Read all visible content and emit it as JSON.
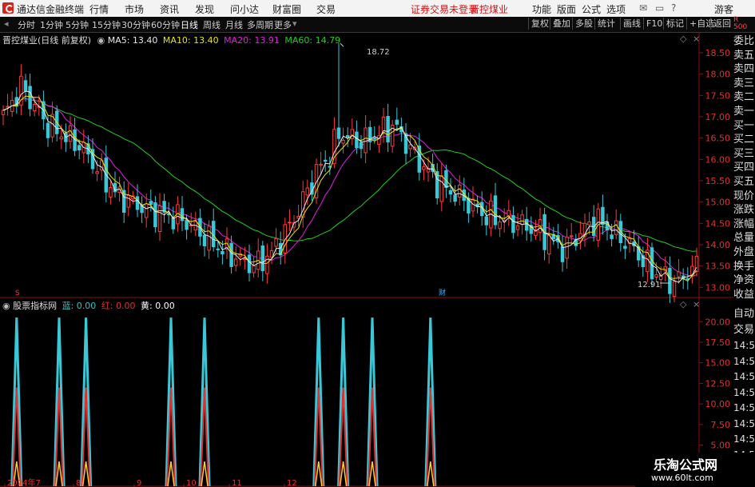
{
  "app": {
    "title": "通达信金融终端",
    "menu": [
      "行情",
      "市场",
      "资讯",
      "发现",
      "问小达",
      "财富圈",
      "交易"
    ],
    "warning": "证券交易未登录",
    "stock_short": "晋控煤业",
    "right_menu": [
      "功能",
      "版面",
      "公式",
      "选项"
    ],
    "user": "游客"
  },
  "toolbar": {
    "periods": [
      "分时",
      "1分钟",
      "5分钟",
      "15分钟",
      "30分钟",
      "60分钟",
      "日线",
      "周线",
      "月线",
      "多周期",
      "更多"
    ],
    "selected": "日线",
    "right": [
      "复权",
      "叠加",
      "多股",
      "统计",
      "画线",
      "F10",
      "标记",
      "+自选",
      "返回"
    ]
  },
  "main_chart": {
    "title": "晋控煤业(日线 前复权)",
    "ma": [
      {
        "label": "MA5: 13.40",
        "color": "#e8e8e8"
      },
      {
        "label": "MA10: 13.40",
        "color": "#e6e600"
      },
      {
        "label": "MA20: 13.91",
        "color": "#e020e0"
      },
      {
        "label": "MA60: 14.79",
        "color": "#20d020"
      }
    ],
    "y_ticks": [
      "18.50",
      "18.00",
      "17.50",
      "17.00",
      "16.50",
      "16.00",
      "15.50",
      "15.00",
      "14.50",
      "14.00",
      "13.50",
      "13.00"
    ],
    "max_label": "18.72",
    "min_label": "12.91",
    "event_marks": [
      "S",
      "财"
    ]
  },
  "sub_chart": {
    "title": "股票指标网",
    "values": [
      {
        "label": "蓝: 0.00",
        "color": "#3fbfbf"
      },
      {
        "label": "红: 0.00",
        "color": "#e03030"
      },
      {
        "label": "黄: 0.00",
        "color": "#ffffff"
      }
    ],
    "y_ticks": [
      "20.00",
      "17.50",
      "15.00",
      "12.50",
      "10.00",
      "7.50",
      "5.00"
    ]
  },
  "x_axis": [
    "2024年7",
    "8",
    "9",
    "10",
    "11",
    "12"
  ],
  "side_panel": {
    "top": [
      "委比",
      "卖五",
      "卖四",
      "卖三",
      "卖二",
      "卖一",
      "买一",
      "买二",
      "买三",
      "买四",
      "买五",
      "现价",
      "涨跌",
      "涨幅",
      "总量",
      "外盘",
      "换手",
      "净资",
      "收益"
    ],
    "lower": [
      "自动",
      "交易",
      "14:56",
      "14:56",
      "14:56",
      "14:56",
      "14:56",
      "14:56",
      "14:56",
      "14:56"
    ]
  },
  "chart_data": {
    "type": "candlestick",
    "series": [
      {
        "name": "MA5",
        "values": [
          13.4
        ]
      },
      {
        "name": "MA10",
        "values": [
          13.4
        ]
      },
      {
        "name": "MA20",
        "values": [
          13.91
        ]
      },
      {
        "name": "MA60",
        "values": [
          14.79
        ]
      }
    ],
    "ylim": [
      12.8,
      18.8
    ],
    "annotations": [
      "18.72",
      "12.91"
    ],
    "indicator": {
      "name": "股票指标网",
      "ylim": [
        0,
        21
      ],
      "spike_days": [
        6,
        25,
        37,
        75,
        90,
        141,
        152,
        165,
        191
      ]
    }
  }
}
